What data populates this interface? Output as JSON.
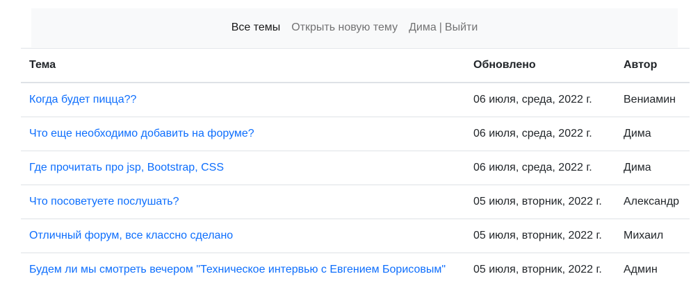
{
  "nav": {
    "all_topics": "Все темы",
    "new_topic": "Открыть новую тему",
    "user": "Дима",
    "separator": "|",
    "logout": "Выйти"
  },
  "table": {
    "headers": {
      "topic": "Тема",
      "updated": "Обновлено",
      "author": "Автор"
    },
    "rows": [
      {
        "topic": "Когда будет пицца??",
        "updated": "06 июля, среда, 2022 г.",
        "author": "Вениамин"
      },
      {
        "topic": "Что еще необходимо добавить на форуме?",
        "updated": "06 июля, среда, 2022 г.",
        "author": "Дима"
      },
      {
        "topic": "Где прочитать про jsp, Bootstrap, CSS",
        "updated": "06 июля, среда, 2022 г.",
        "author": "Дима"
      },
      {
        "topic": "Что посоветуете послушать?",
        "updated": "05 июля, вторник, 2022 г.",
        "author": "Александр"
      },
      {
        "topic": "Отличный форум, все классно сделано",
        "updated": "05 июля, вторник, 2022 г.",
        "author": "Михаил"
      },
      {
        "topic": "Будем ли мы смотреть вечером \"Техническое интервью с Евгением Борисовым\"",
        "updated": "05 июля, вторник, 2022 г.",
        "author": "Админ"
      }
    ]
  },
  "colors": {
    "link": "#0d6efd",
    "navbar_bg": "#f8f9fa",
    "border": "#dee2e6"
  }
}
